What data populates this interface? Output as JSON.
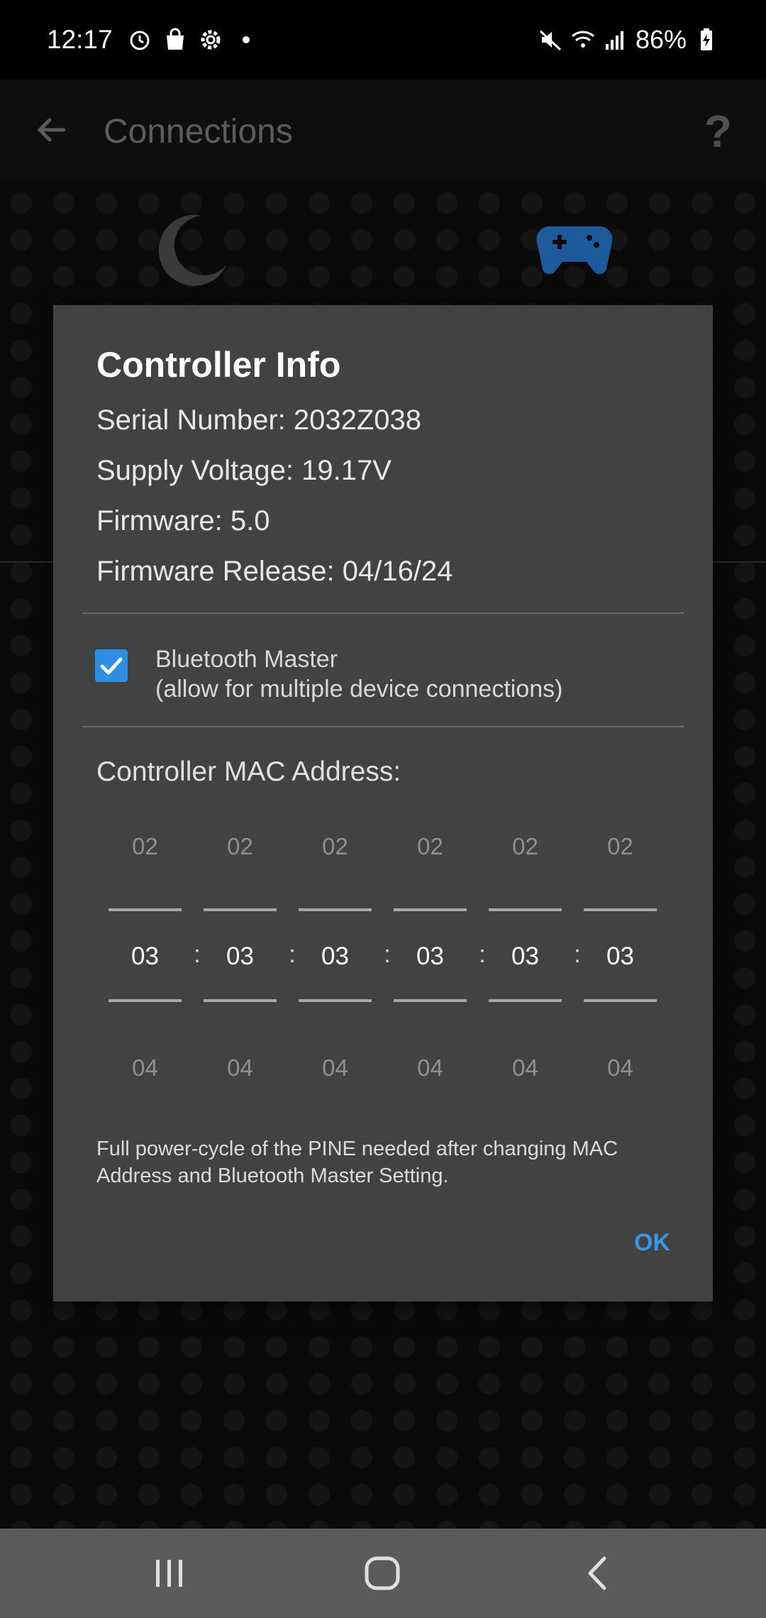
{
  "status_bar": {
    "time": "12:17",
    "battery": "86%",
    "icons": [
      "alarm-icon",
      "shopping-bag-icon",
      "settings-icon",
      "dot-icon",
      "mute-icon",
      "wifi-icon",
      "signal-icon",
      "battery-charging-icon"
    ]
  },
  "app_bar": {
    "title": "Connections",
    "help": "?"
  },
  "dialog": {
    "title": "Controller Info",
    "serial": "Serial Number: 2032Z038",
    "voltage": "Supply Voltage: 19.17V",
    "firmware": "Firmware: 5.0",
    "firmware_release": "Firmware Release: 04/16/24",
    "bluetooth_master_checked": true,
    "bluetooth_master_label": "Bluetooth Master",
    "bluetooth_master_sub": "(allow for multiple device connections)",
    "mac_label": "Controller MAC Address:",
    "mac_pickers": [
      {
        "prev": "02",
        "current": "03",
        "next": "04"
      },
      {
        "prev": "02",
        "current": "03",
        "next": "04"
      },
      {
        "prev": "02",
        "current": "03",
        "next": "04"
      },
      {
        "prev": "02",
        "current": "03",
        "next": "04"
      },
      {
        "prev": "02",
        "current": "03",
        "next": "04"
      },
      {
        "prev": "02",
        "current": "03",
        "next": "04"
      }
    ],
    "separator": ":",
    "note": "Full power-cycle of the PINE needed after changing MAC Address and Bluetooth Master Setting.",
    "ok_label": "OK"
  },
  "colors": {
    "accent": "#3996e6",
    "checkbox": "#2f8de4",
    "dialog_bg": "#424242",
    "gamepad": "#1d5a9c"
  }
}
